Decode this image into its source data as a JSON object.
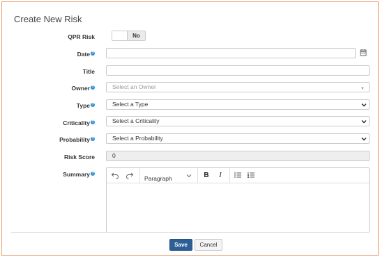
{
  "form": {
    "title": "Create New Risk",
    "help_glyph": "?"
  },
  "qpr_risk": {
    "label": "QPR Risk",
    "toggle_value": "No"
  },
  "date": {
    "label": "Date",
    "value": ""
  },
  "title_field": {
    "label": "Title",
    "value": ""
  },
  "owner": {
    "label": "Owner",
    "placeholder": "Select an Owner"
  },
  "type": {
    "label": "Type",
    "selected": "Select a Type"
  },
  "criticality": {
    "label": "Criticality",
    "selected": "Select a Criticality"
  },
  "probability": {
    "label": "Probability",
    "selected": "Select a Probability"
  },
  "risk_score": {
    "label": "Risk Score",
    "value": "0"
  },
  "summary": {
    "label": "Summary",
    "toolbar": {
      "undo_icon": "undo-icon",
      "redo_icon": "redo-icon",
      "block_format": "Paragraph",
      "bold": "B",
      "italic": "I",
      "bullet_list_icon": "bullet-list-icon",
      "numbered_list_icon": "numbered-list-icon"
    },
    "content": ""
  },
  "actions": {
    "save_label": "Save",
    "cancel_label": "Cancel"
  },
  "colors": {
    "accent": "#2c5f96",
    "help": "#2a8fd6",
    "frame": "#f0a070"
  }
}
